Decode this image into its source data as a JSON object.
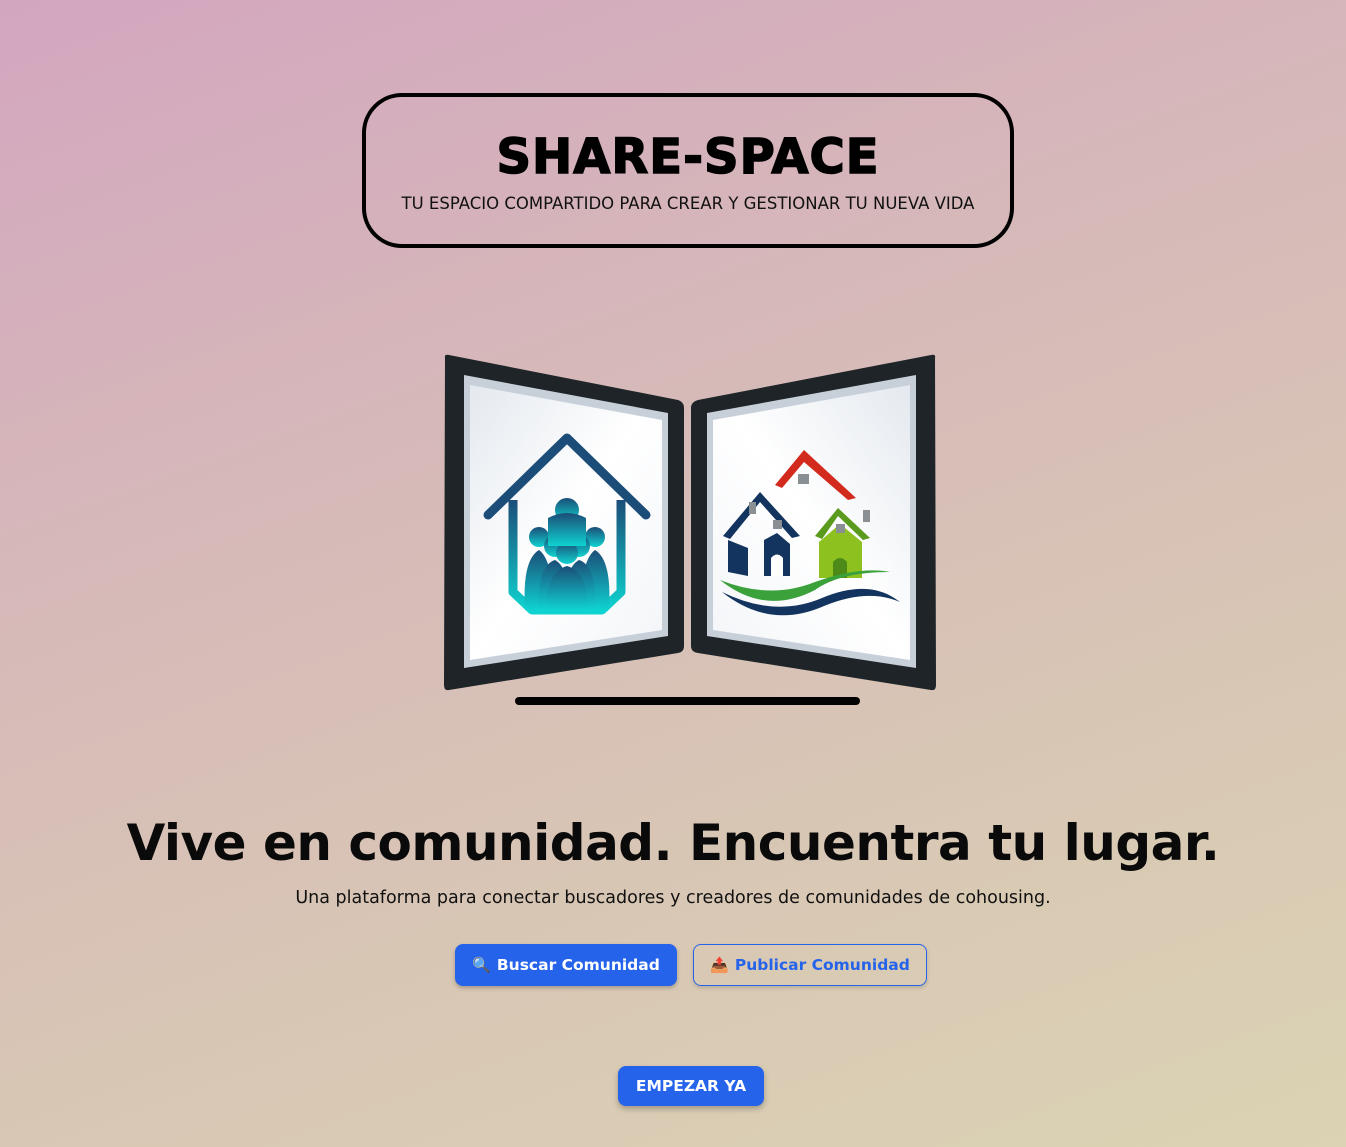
{
  "brand": {
    "title": "SHARE-SPACE",
    "tagline": "TU ESPACIO COMPARTIDO PARA CREAR Y GESTIONAR TU NUEVA VIDA"
  },
  "hero": {
    "headline": "Vive en comunidad. Encuentra tu lugar.",
    "subtitle": "Una plataforma para conectar buscadores y creadores de comunidades de cohousing."
  },
  "actions": {
    "search": {
      "icon": "🔍",
      "label": "Buscar Comunidad"
    },
    "publish": {
      "icon": "📤",
      "label": "Publicar Comunidad"
    }
  },
  "cta": {
    "label": "EMPEZAR YA"
  },
  "colors": {
    "accent": "#2563eb",
    "background_start": "#d3a6bf",
    "background_end": "#dbd3b3"
  }
}
